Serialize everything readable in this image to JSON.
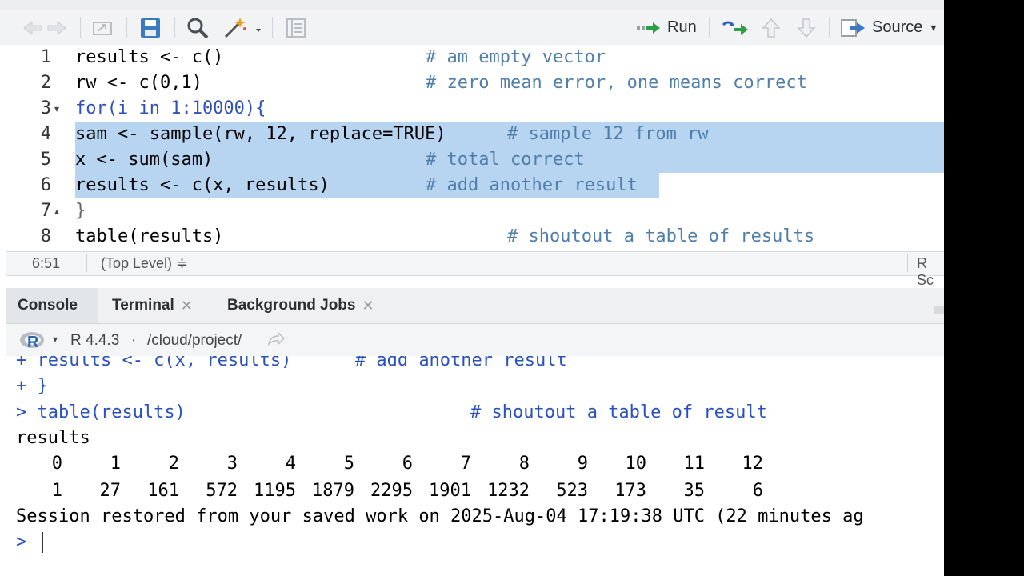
{
  "toolbar": {
    "run_label": "Run",
    "source_label": "Source"
  },
  "editor": {
    "lines": [
      {
        "num": "1",
        "fold": "",
        "code": "results <- c()",
        "comment": "# am empty vector"
      },
      {
        "num": "2",
        "fold": "",
        "code": "rw <- c(0,1)",
        "comment": "# zero mean error, one means correct"
      },
      {
        "num": "3",
        "fold": "▾",
        "code": "for(i in 1:10000){",
        "comment": ""
      },
      {
        "num": "4",
        "fold": "",
        "code": "sam <- sample(rw, 12, replace=TRUE)",
        "comment": "# sample 12 from rw"
      },
      {
        "num": "5",
        "fold": "",
        "code": "x <- sum(sam)",
        "comment": "# total correct"
      },
      {
        "num": "6",
        "fold": "",
        "code": "results <- c(x, results)",
        "comment": "# add another result"
      },
      {
        "num": "7",
        "fold": "▴",
        "code": "}",
        "comment": ""
      },
      {
        "num": "8",
        "fold": "",
        "code": "table(results)",
        "comment": "# shoutout a table of results"
      }
    ]
  },
  "statusbar": {
    "cursor_pos": "6:51",
    "scope": "(Top Level) ≑",
    "filetype": "R Sc"
  },
  "console_tabs": [
    {
      "label": "Console",
      "closable": false,
      "active": true
    },
    {
      "label": "Terminal",
      "closable": true,
      "active": false
    },
    {
      "label": "Background Jobs",
      "closable": true,
      "active": false
    }
  ],
  "console_header": {
    "r_version": "R 4.4.3",
    "separator": "·",
    "path": "/cloud/project/"
  },
  "console": {
    "line1": "+ results <- c(x, results)      # add another result",
    "line2": "+ }",
    "line3_cmd": "> table(results)",
    "line3_comment": "# shoutout a table of result",
    "line4": "results",
    "table_header": [
      "0",
      "1",
      "2",
      "3",
      "4",
      "5",
      "6",
      "7",
      "8",
      "9",
      "10",
      "11",
      "12"
    ],
    "table_values": [
      "1",
      "27",
      "161",
      "572",
      "1195",
      "1879",
      "2295",
      "1901",
      "1232",
      "523",
      "173",
      "35",
      "6"
    ],
    "session_msg": "Session restored from your saved work on 2025-Aug-04 17:19:38 UTC (22 minutes ag",
    "prompt": ">"
  }
}
